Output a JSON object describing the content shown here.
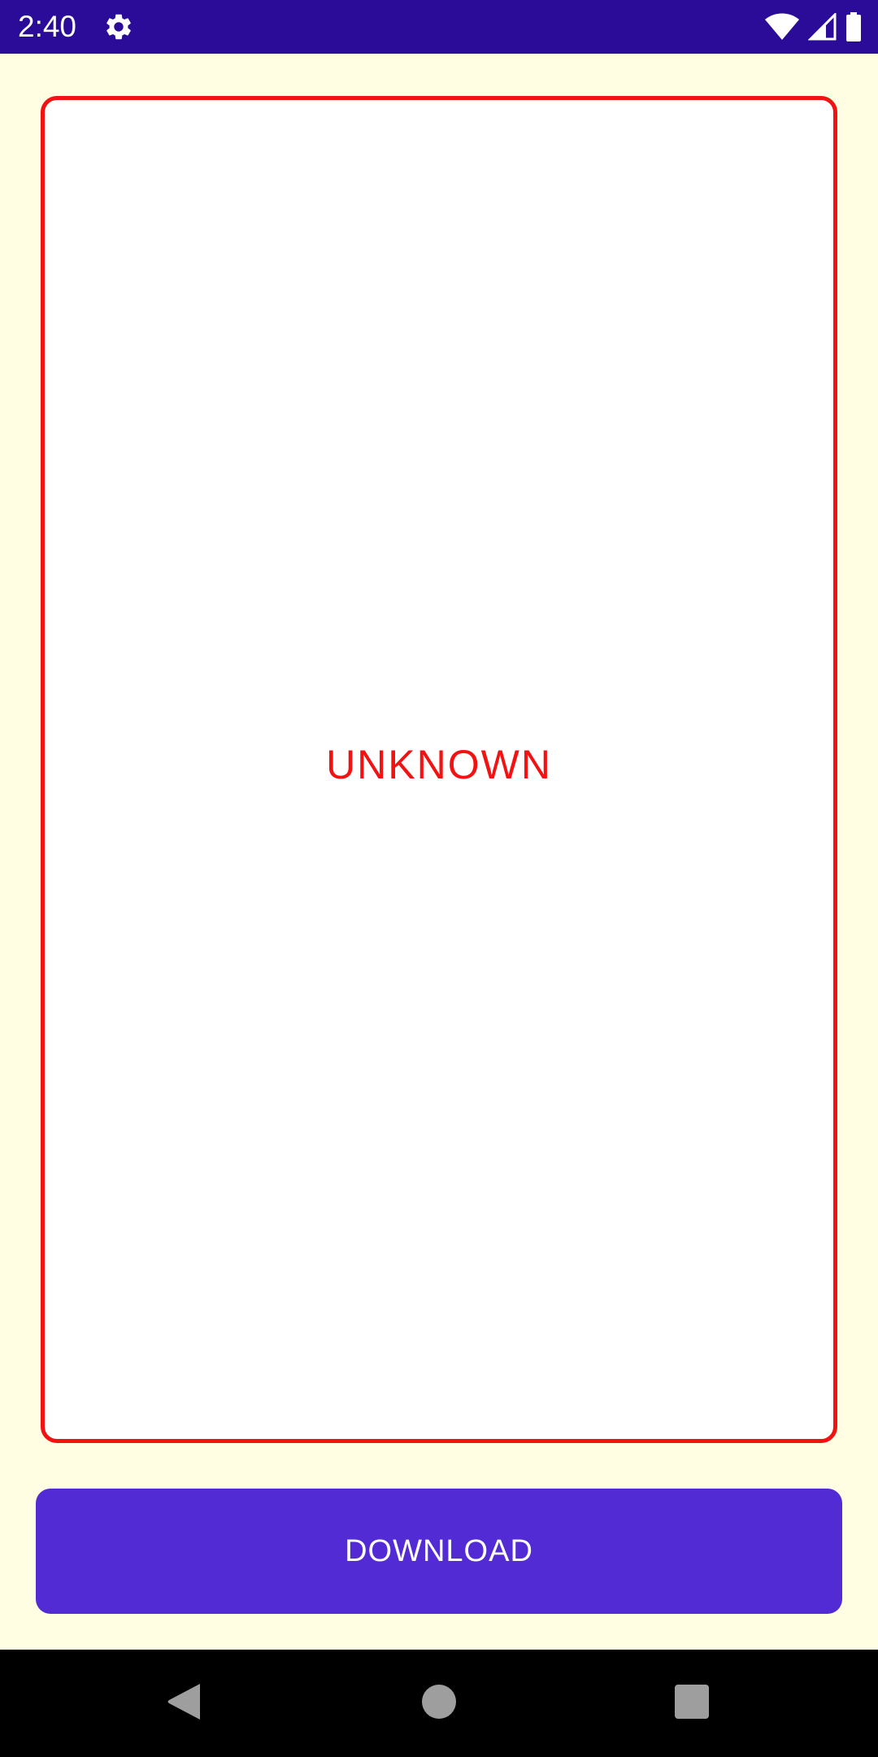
{
  "status_bar": {
    "time": "2:40",
    "icons": [
      "gear-icon",
      "wifi-icon",
      "signal-icon",
      "battery-icon"
    ],
    "background": "#2B0C98"
  },
  "main": {
    "status_label": "UNKNOWN",
    "status_color": "#F21212",
    "download_label": "DOWNLOAD",
    "button_color": "#522BD4",
    "background": "#FFFDE2"
  },
  "nav_bar": {
    "icons": [
      "back-icon",
      "home-icon",
      "recents-icon"
    ]
  }
}
